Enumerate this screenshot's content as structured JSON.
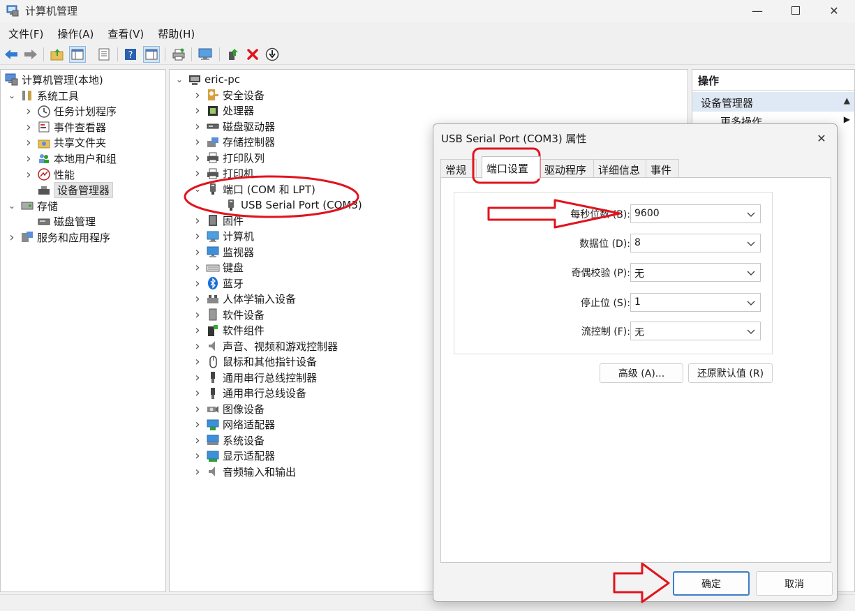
{
  "window": {
    "title": "计算机管理",
    "colors": {
      "accent": "#0f6cbd",
      "annotation": "#e0141e",
      "selection": "#e5e5e5"
    }
  },
  "menu": [
    "文件(F)",
    "操作(A)",
    "查看(V)",
    "帮助(H)"
  ],
  "toolbar_icons": [
    "back-arrow-icon",
    "forward-arrow-icon",
    "up-folder-icon",
    "show-tree-icon",
    "properties-icon",
    "help-icon",
    "show-action-pane-icon",
    "print-icon",
    "computer-monitor-icon",
    "update-driver-icon",
    "uninstall-icon",
    "scan-hardware-icon"
  ],
  "left_tree": {
    "root": "计算机管理(本地)",
    "items": [
      {
        "label": "系统工具",
        "icon": "tools-icon",
        "level": 1,
        "expanded": true
      },
      {
        "label": "任务计划程序",
        "icon": "clock-icon",
        "level": 2
      },
      {
        "label": "事件查看器",
        "icon": "event-viewer-icon",
        "level": 2
      },
      {
        "label": "共享文件夹",
        "icon": "shared-folder-icon",
        "level": 2
      },
      {
        "label": "本地用户和组",
        "icon": "users-icon",
        "level": 2
      },
      {
        "label": "性能",
        "icon": "performance-icon",
        "level": 2
      },
      {
        "label": "设备管理器",
        "icon": "device-manager-icon",
        "level": 2,
        "selected": true
      },
      {
        "label": "存储",
        "icon": "storage-icon",
        "level": 1,
        "expanded": true
      },
      {
        "label": "磁盘管理",
        "icon": "disk-icon",
        "level": 2
      },
      {
        "label": "服务和应用程序",
        "icon": "services-icon",
        "level": 1
      }
    ]
  },
  "device_tree": {
    "root": "eric-pc",
    "items": [
      {
        "label": "安全设备",
        "icon": "security-device-icon"
      },
      {
        "label": "处理器",
        "icon": "processor-icon"
      },
      {
        "label": "磁盘驱动器",
        "icon": "disk-drive-icon"
      },
      {
        "label": "存储控制器",
        "icon": "storage-controller-icon"
      },
      {
        "label": "打印队列",
        "icon": "printer-icon"
      },
      {
        "label": "打印机",
        "icon": "printer-icon"
      },
      {
        "label": "端口 (COM 和 LPT)",
        "icon": "port-icon",
        "expanded": true
      },
      {
        "label": "USB Serial Port (COM3)",
        "icon": "port-icon",
        "child": true
      },
      {
        "label": "固件",
        "icon": "firmware-icon"
      },
      {
        "label": "计算机",
        "icon": "computer-icon"
      },
      {
        "label": "监视器",
        "icon": "monitor-icon"
      },
      {
        "label": "键盘",
        "icon": "keyboard-icon"
      },
      {
        "label": "蓝牙",
        "icon": "bluetooth-icon"
      },
      {
        "label": "人体学输入设备",
        "icon": "hid-icon"
      },
      {
        "label": "软件设备",
        "icon": "software-device-icon"
      },
      {
        "label": "软件组件",
        "icon": "software-component-icon"
      },
      {
        "label": "声音、视频和游戏控制器",
        "icon": "speaker-icon"
      },
      {
        "label": "鼠标和其他指针设备",
        "icon": "mouse-icon"
      },
      {
        "label": "通用串行总线控制器",
        "icon": "usb-icon"
      },
      {
        "label": "通用串行总线设备",
        "icon": "usb-icon"
      },
      {
        "label": "图像设备",
        "icon": "camera-icon"
      },
      {
        "label": "网络适配器",
        "icon": "network-adapter-icon"
      },
      {
        "label": "系统设备",
        "icon": "system-device-icon"
      },
      {
        "label": "显示适配器",
        "icon": "display-adapter-icon"
      },
      {
        "label": "音频输入和输出",
        "icon": "speaker-icon"
      }
    ]
  },
  "actions": {
    "header": "操作",
    "section": "设备管理器",
    "more": "更多操作"
  },
  "dialog": {
    "title": "USB Serial Port (COM3) 属性",
    "tabs": [
      "常规",
      "端口设置",
      "驱动程序",
      "详细信息",
      "事件"
    ],
    "active_tab": "端口设置",
    "fields": [
      {
        "label": "每秒位数 (B):",
        "value": "9600"
      },
      {
        "label": "数据位 (D):",
        "value": "8"
      },
      {
        "label": "奇偶校验 (P):",
        "value": "无"
      },
      {
        "label": "停止位 (S):",
        "value": "1"
      },
      {
        "label": "流控制 (F):",
        "value": "无"
      }
    ],
    "advanced_button": "高级 (A)...",
    "restore_button": "还原默认值 (R)",
    "ok_button": "确定",
    "cancel_button": "取消"
  }
}
